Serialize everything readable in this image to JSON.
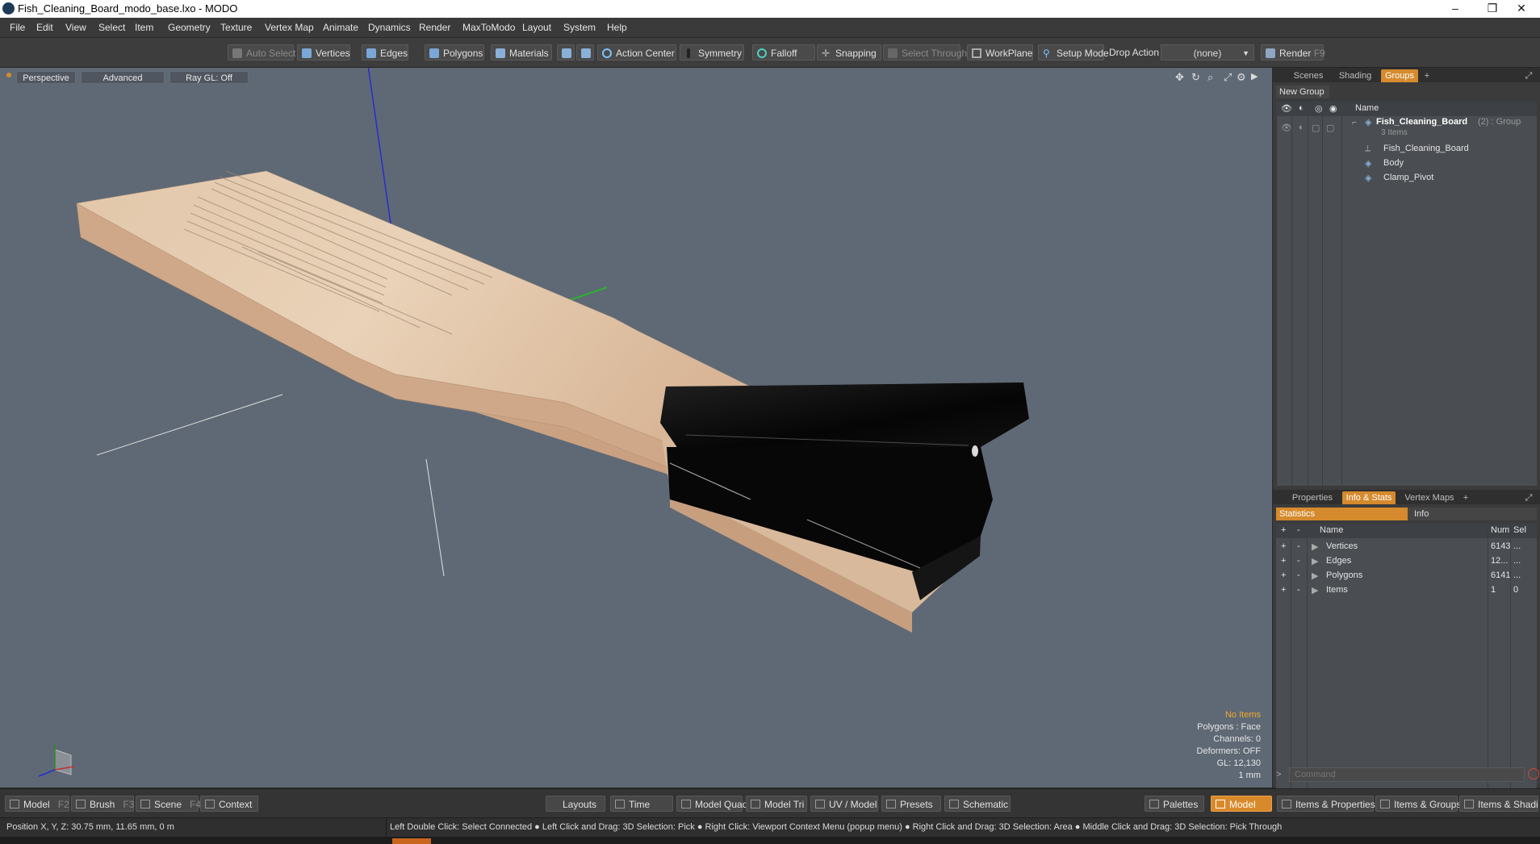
{
  "window": {
    "title": "Fish_Cleaning_Board_modo_base.lxo - MODO",
    "minimize": "–",
    "restore": "❐",
    "close": "✕"
  },
  "menu": [
    "File",
    "Edit",
    "View",
    "Select",
    "Item",
    "Geometry",
    "Texture",
    "Vertex Map",
    "Animate",
    "Dynamics",
    "Render",
    "MaxToModo",
    "Layout",
    "System",
    "Help"
  ],
  "toolbar": {
    "auto_select": "Auto Select",
    "vertices": "Vertices",
    "edges": "Edges",
    "polygons": "Polygons",
    "materials": "Materials",
    "action_center": "Action Center",
    "symmetry": "Symmetry",
    "falloff": "Falloff",
    "snapping": "Snapping",
    "select_through": "Select Through",
    "workplane": "WorkPlane",
    "setup_mode": "Setup Mode",
    "drop_action_label": "Drop Action",
    "drop_action_value": "(none)",
    "render": "Render",
    "render_key": "F9"
  },
  "viewport": {
    "perspective": "Perspective",
    "advanced": "Advanced",
    "ray_gl": "Ray GL: Off",
    "info": {
      "no_items": "No Items",
      "polygons": "Polygons : Face",
      "channels": "Channels: 0",
      "deformers": "Deformers: OFF",
      "gl": "GL: 12,130",
      "scale": "1 mm"
    }
  },
  "scene_panel": {
    "tabs": [
      "Scenes",
      "Shading",
      "Groups"
    ],
    "active_tab": "Groups",
    "new_group": "New Group",
    "name_header": "Name",
    "group_name": "Fish_Cleaning_Board",
    "group_suffix": "(2) : Group",
    "group_count": "3 Items",
    "items": [
      "Fish_Cleaning_Board",
      "Body",
      "Clamp_Pivot"
    ]
  },
  "stats_panel": {
    "tabs": [
      "Properties",
      "Info & Stats",
      "Vertex Maps"
    ],
    "active_tab": "Info & Stats",
    "sub_tabs": [
      "Statistics",
      "Info"
    ],
    "headers": {
      "name": "Name",
      "num": "Num",
      "sel": "Sel"
    },
    "rows": [
      {
        "name": "Vertices",
        "num": "6143",
        "sel": "..."
      },
      {
        "name": "Edges",
        "num": "12...",
        "sel": "..."
      },
      {
        "name": "Polygons",
        "num": "6141",
        "sel": "..."
      },
      {
        "name": "Items",
        "num": "1",
        "sel": "0"
      }
    ],
    "command_placeholder": "Command"
  },
  "bottom_tabs": {
    "left": [
      {
        "label": "Model",
        "key": "F2"
      },
      {
        "label": "Brush",
        "key": "F3"
      },
      {
        "label": "Scene",
        "key": "F4"
      },
      {
        "label": "Context",
        "key": ""
      }
    ],
    "center": [
      "Layouts",
      "Time",
      "Model Quad",
      "Model Tri",
      "UV / Model",
      "Presets",
      "Schematic"
    ],
    "palettes": "Palettes",
    "model": "Model",
    "right": [
      "Items & Properties",
      "Items & Groups",
      "Items & Shading"
    ]
  },
  "status": {
    "position": "Position X, Y, Z:   30.75 mm, 11.65 mm, 0 m",
    "hints": "Left Double Click: Select Connected ● Left Click and Drag: 3D Selection: Pick ● Right Click: Viewport Context Menu (popup menu) ● Right Click and Drag: 3D Selection: Area ● Middle Click and Drag: 3D Selection: Pick Through"
  },
  "colors": {
    "accent": "#d58a2d",
    "viewport_bg": "#5f6975",
    "panel_bg": "#3b3b3b"
  }
}
